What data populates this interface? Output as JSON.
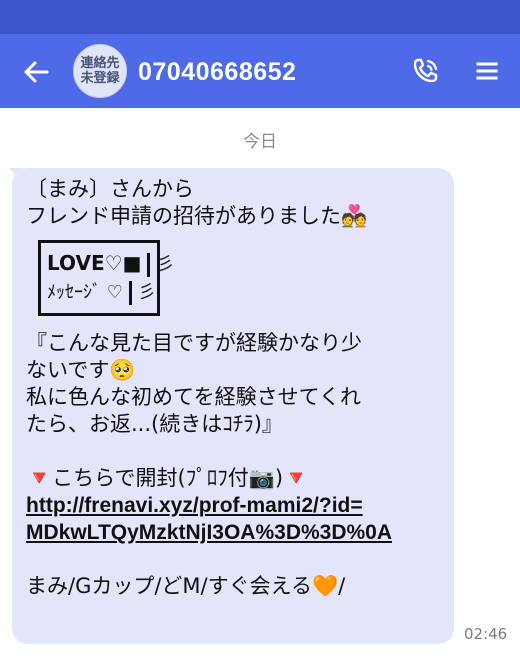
{
  "header": {
    "back_icon": "arrow-left-icon",
    "avatar_line1": "連絡先",
    "avatar_line2": "未登録",
    "contact_number": "07040668652",
    "call_icon": "phone-call-icon",
    "menu_icon": "hamburger-menu-icon",
    "colors": {
      "bar": "#4e6ae6",
      "status": "#3a55c9"
    }
  },
  "conversation": {
    "date_label": "今日",
    "message": {
      "line1": "〔まみ〕さんから",
      "line2": "フレンド申請の招待がありました💑",
      "badge_line1": "LOVE♡■",
      "badge_line2": "ﾒｯｾｰｼﾞ ♡",
      "badge_squiggle": "彡",
      "line3": "『こんな見た目ですが経験かなり少",
      "line4": "ないです🥺",
      "line5": "私に色んな初めてを経験させてくれ",
      "line6": "たら、お返...(続きはｺﾁﾗ)』",
      "line7": "🔻こちらで開封(ﾌﾟﾛﾌ付📷)🔻",
      "link_line1": "http://frenavi.xyz/prof-mami2/?id=",
      "link_line2": "MDkwLTQyMzktNjI3OA%3D%3D%0A",
      "line8": "まみ/Gカップ/どM/すぐ会える🧡/"
    },
    "timestamp": "02:46",
    "bubble_color": "#e3e6fb"
  }
}
